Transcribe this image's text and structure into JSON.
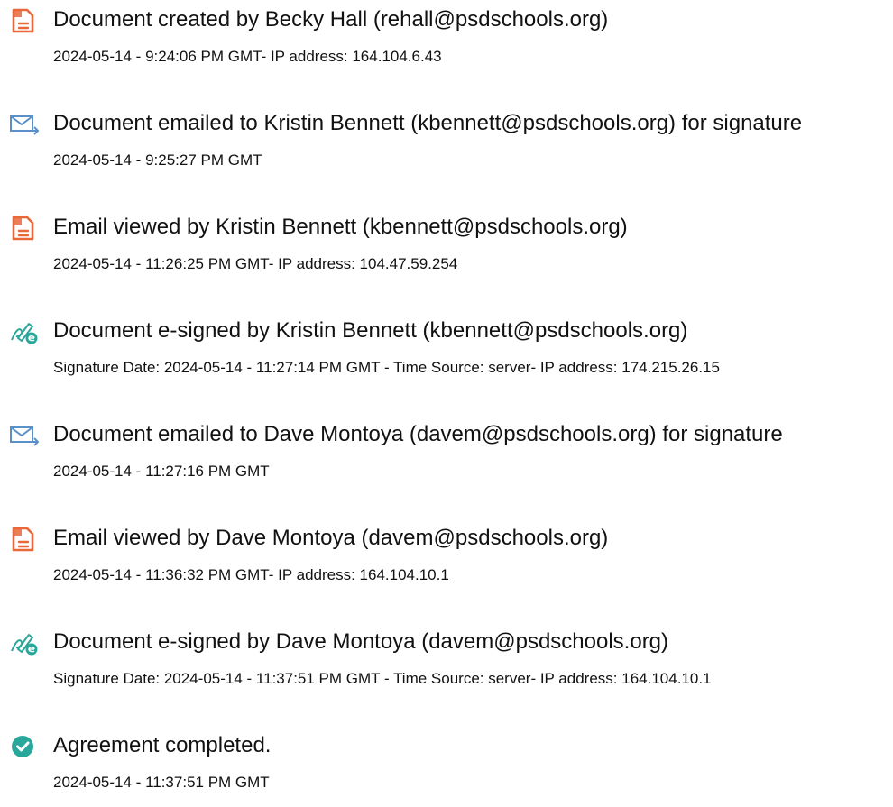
{
  "audit_log": {
    "colors": {
      "document_icon": "#e8683a",
      "email_icon": "#5b8fc7",
      "signature_icon": "#2aa79b",
      "complete_icon": "#2aa79b"
    },
    "events": [
      {
        "icon": "document-icon",
        "title": "Document created by Becky Hall (rehall@psdschools.org)",
        "detail": "2024-05-14 - 9:24:06 PM GMT- IP address: 164.104.6.43"
      },
      {
        "icon": "email-sent-icon",
        "title": "Document emailed to Kristin Bennett (kbennett@psdschools.org) for signature",
        "detail": "2024-05-14 - 9:25:27 PM GMT"
      },
      {
        "icon": "document-icon",
        "title": "Email viewed by Kristin Bennett (kbennett@psdschools.org)",
        "detail": "2024-05-14 - 11:26:25 PM GMT- IP address: 104.47.59.254"
      },
      {
        "icon": "signature-icon",
        "title": "Document e-signed by Kristin Bennett (kbennett@psdschools.org)",
        "detail": "Signature Date: 2024-05-14 - 11:27:14 PM GMT - Time Source: server- IP address: 174.215.26.15"
      },
      {
        "icon": "email-sent-icon",
        "title": "Document emailed to Dave Montoya (davem@psdschools.org) for signature",
        "detail": "2024-05-14 - 11:27:16 PM GMT"
      },
      {
        "icon": "document-icon",
        "title": "Email viewed by Dave Montoya (davem@psdschools.org)",
        "detail": "2024-05-14 - 11:36:32 PM GMT- IP address: 164.104.10.1"
      },
      {
        "icon": "signature-icon",
        "title": "Document e-signed by Dave Montoya (davem@psdschools.org)",
        "detail": "Signature Date: 2024-05-14 - 11:37:51 PM GMT - Time Source: server- IP address: 164.104.10.1"
      },
      {
        "icon": "check-circle-icon",
        "title": "Agreement completed.",
        "detail": "2024-05-14 - 11:37:51 PM GMT"
      }
    ]
  }
}
